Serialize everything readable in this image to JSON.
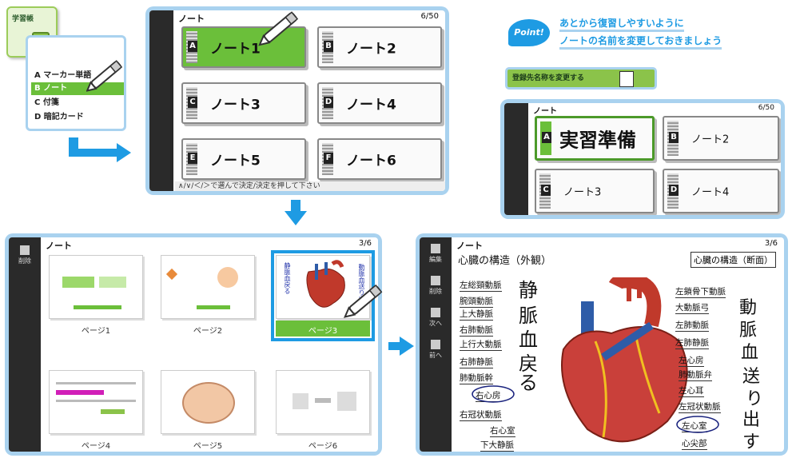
{
  "menu": {
    "tab_label": "学習帳",
    "items": [
      {
        "key": "A",
        "label": "マーカー単語"
      },
      {
        "key": "B",
        "label": "ノート"
      },
      {
        "key": "C",
        "label": "付箋"
      },
      {
        "key": "D",
        "label": "暗記カード"
      }
    ]
  },
  "note_screen": {
    "title": "ノート",
    "count": "6/50",
    "hint": "∧/∨/＜/＞で選んで決定/決定を押して下さい",
    "notes": [
      {
        "key": "A",
        "label": "ノート1"
      },
      {
        "key": "B",
        "label": "ノート2"
      },
      {
        "key": "C",
        "label": "ノート3"
      },
      {
        "key": "D",
        "label": "ノート4"
      },
      {
        "key": "E",
        "label": "ノート5"
      },
      {
        "key": "F",
        "label": "ノート6"
      }
    ]
  },
  "point": {
    "badge": "Point!",
    "line1": "あとから復習しやすいように",
    "line2": "ノートの名前を変更しておきましょう",
    "rename_button": "登録先名称を変更する"
  },
  "renamed_screen": {
    "title": "ノート",
    "count": "6/50",
    "notes": [
      {
        "key": "A",
        "label": "実習準備"
      },
      {
        "key": "B",
        "label": "ノート2"
      },
      {
        "key": "C",
        "label": "ノート3"
      },
      {
        "key": "D",
        "label": "ノート4"
      }
    ]
  },
  "pages_screen": {
    "title": "ノート",
    "count": "3/6",
    "delete_label": "削除",
    "pages": [
      "ページ1",
      "ページ2",
      "ページ3",
      "ページ4",
      "ページ5",
      "ページ6"
    ],
    "thumb3_vertical_text": "静脈血戻る",
    "thumb3_right_text": "動脈血送り出す"
  },
  "heart_screen": {
    "title": "ノート",
    "count": "3/6",
    "sidebar": [
      "編集",
      "削除",
      "次へ",
      "前へ"
    ],
    "heading": "心臓の構造（外観）",
    "heading_right": "心臓の構造（断面）",
    "left_labels": [
      "左総頸動脈",
      "腕頭動脈",
      "上大静脈",
      "右肺動脈",
      "上行大動脈",
      "右肺静脈",
      "肺動脈幹",
      "右心房",
      "右冠状動脈",
      "右心室",
      "下大静脈"
    ],
    "right_labels": [
      "左鎖骨下動脈",
      "大動脈弓",
      "左肺動脈",
      "左肺静脈",
      "左心房",
      "肺動脈弁",
      "左心耳",
      "左冠状動脈",
      "左心室",
      "心尖部"
    ],
    "handwriting_left": [
      "静",
      "脈",
      "血",
      "戻",
      "る"
    ],
    "handwriting_right": [
      "動",
      "脈",
      "血",
      "送",
      "り",
      "出",
      "す"
    ]
  },
  "colors": {
    "accent_blue": "#1e9be3",
    "light_blue": "#a9d2ef",
    "green": "#6bbf3a"
  }
}
